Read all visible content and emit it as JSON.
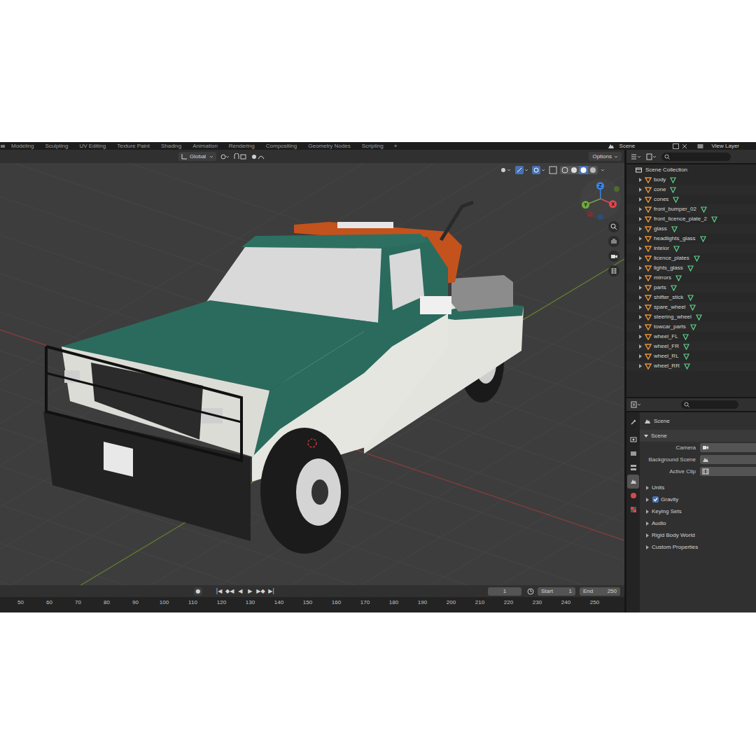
{
  "topbar": {
    "workspaces": [
      {
        "label": "Modeling",
        "selected": false
      },
      {
        "label": "Sculpting",
        "selected": false
      },
      {
        "label": "UV Editing",
        "selected": false
      },
      {
        "label": "Texture Paint",
        "selected": false
      },
      {
        "label": "Shading",
        "selected": false
      },
      {
        "label": "Animation",
        "selected": false
      },
      {
        "label": "Rendering",
        "selected": false
      },
      {
        "label": "Compositing",
        "selected": false
      },
      {
        "label": "Geometry Nodes",
        "selected": false
      },
      {
        "label": "Scripting",
        "selected": false
      }
    ],
    "add": "+",
    "scene": "Scene",
    "view_layer": "View Layer"
  },
  "viewport": {
    "orientation": "Global",
    "options": "Options",
    "gizmo_axes": [
      {
        "label": "Z",
        "color": "#3b84e0"
      },
      {
        "label": "Y",
        "color": "#73a83f"
      },
      {
        "label": "X",
        "color": "#e2474d"
      }
    ]
  },
  "timeline": {
    "record": "●",
    "controls": [
      "|◀",
      "◆◀",
      "◀",
      "▶",
      "▶◆",
      "▶|"
    ],
    "current_frame": "1",
    "start_label": "Start",
    "start": "1",
    "end_label": "End",
    "end": "250",
    "ruler": [
      "50",
      "60",
      "70",
      "80",
      "90",
      "100",
      "110",
      "120",
      "130",
      "140",
      "150",
      "160",
      "170",
      "180",
      "190",
      "200",
      "210",
      "220",
      "230",
      "240",
      "250"
    ]
  },
  "outliner": {
    "root": "Scene Collection",
    "items": [
      {
        "name": "body"
      },
      {
        "name": "cone"
      },
      {
        "name": "cones"
      },
      {
        "name": "front_bumper_02"
      },
      {
        "name": "front_licence_plate_2"
      },
      {
        "name": "glass"
      },
      {
        "name": "headlights_glass"
      },
      {
        "name": "inteior"
      },
      {
        "name": "licence_plates"
      },
      {
        "name": "lights_glass"
      },
      {
        "name": "mirrors"
      },
      {
        "name": "parts"
      },
      {
        "name": "shifter_stick"
      },
      {
        "name": "spare_wheel"
      },
      {
        "name": "steering_wheel"
      },
      {
        "name": "towcar_parts"
      },
      {
        "name": "wheel_FL"
      },
      {
        "name": "wheel_FR"
      },
      {
        "name": "wheel_RL"
      },
      {
        "name": "wheel_RR"
      }
    ]
  },
  "properties": {
    "tabs": [
      {
        "selected": false
      },
      {
        "selected": false
      },
      {
        "selected": false
      },
      {
        "selected": false
      },
      {
        "selected": true
      },
      {
        "selected": false
      },
      {
        "selected": false
      }
    ],
    "breadcrumb": "Scene",
    "panel": {
      "label": "Scene",
      "expanded": true
    },
    "fields": [
      "Camera",
      "Background Scene",
      "Active Clip"
    ],
    "subpanels": [
      {
        "label": "Units",
        "kind": "section"
      },
      {
        "label": "Gravity",
        "kind": "checkbox",
        "checked": true
      },
      {
        "label": "Keying Sets",
        "kind": "section"
      },
      {
        "label": "Audio",
        "kind": "section"
      },
      {
        "label": "Rigid Body World",
        "kind": "section"
      },
      {
        "label": "Custom Properties",
        "kind": "section"
      }
    ]
  }
}
